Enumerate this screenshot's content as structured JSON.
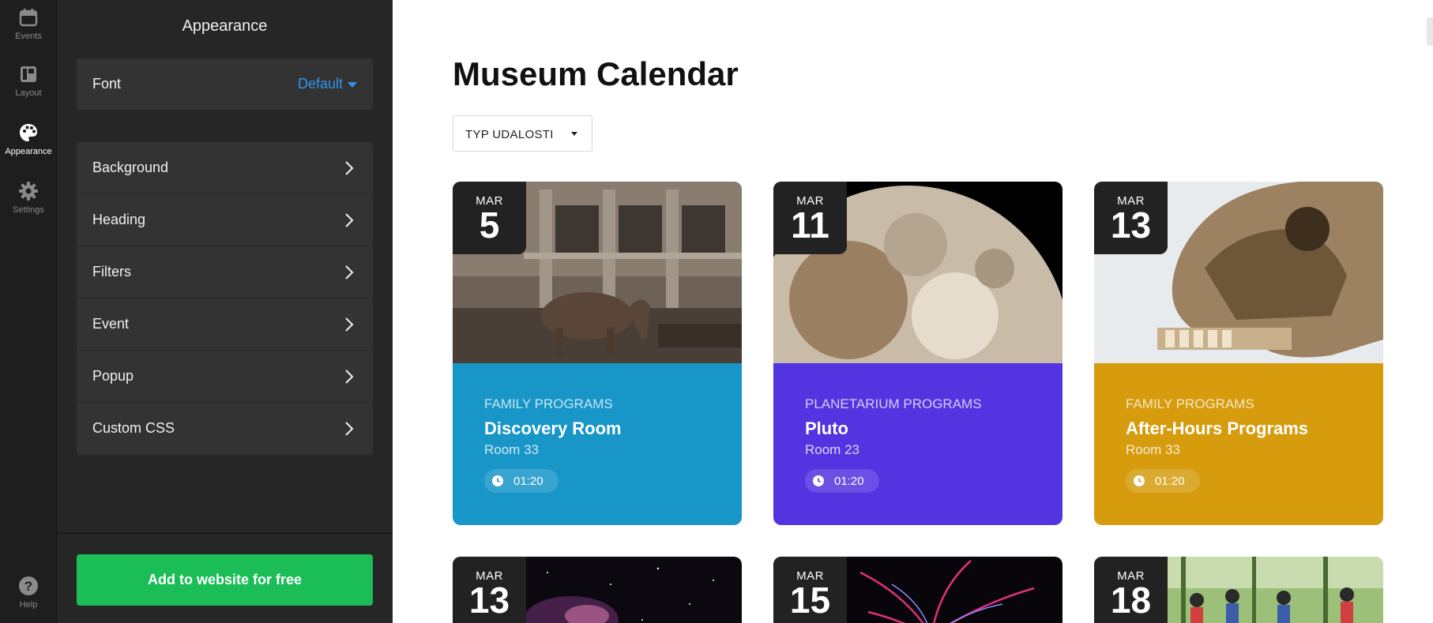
{
  "rail": {
    "items": [
      {
        "label": "Events",
        "icon": "calendar-icon",
        "active": false
      },
      {
        "label": "Layout",
        "icon": "layout-icon",
        "active": false
      },
      {
        "label": "Appearance",
        "icon": "palette-icon",
        "active": true
      },
      {
        "label": "Settings",
        "icon": "gear-icon",
        "active": false
      }
    ],
    "help": {
      "label": "Help",
      "icon": "question-icon"
    }
  },
  "panel": {
    "title": "Appearance",
    "font": {
      "label": "Font",
      "value": "Default"
    },
    "menu": [
      {
        "label": "Background"
      },
      {
        "label": "Heading"
      },
      {
        "label": "Filters"
      },
      {
        "label": "Event"
      },
      {
        "label": "Popup"
      },
      {
        "label": "Custom CSS"
      }
    ],
    "cta": "Add to website for free"
  },
  "main": {
    "title": "Museum Calendar",
    "filter_label": "TYP UDALOSTI",
    "cards": [
      {
        "month": "MAR",
        "day": "5",
        "category": "FAMILY PROGRAMS",
        "name": "Discovery Room",
        "room": "Room 33",
        "time": "01:20",
        "color": "#1896c8",
        "image": "museum-hall-elephant"
      },
      {
        "month": "MAR",
        "day": "11",
        "category": "PLANETARIUM PROGRAMS",
        "name": "Pluto",
        "room": "Room 23",
        "time": "01:20",
        "color": "#5234e0",
        "image": "pluto-planet"
      },
      {
        "month": "MAR",
        "day": "13",
        "category": "FAMILY PROGRAMS",
        "name": "After-Hours Programs",
        "room": "Room 33",
        "time": "01:20",
        "color": "#d69c0e",
        "image": "fossil-skull"
      },
      {
        "month": "MAR",
        "day": "13",
        "image": "nebula-space"
      },
      {
        "month": "MAR",
        "day": "15",
        "image": "plasma-ball"
      },
      {
        "month": "MAR",
        "day": "18",
        "image": "people-outdoors"
      }
    ]
  }
}
